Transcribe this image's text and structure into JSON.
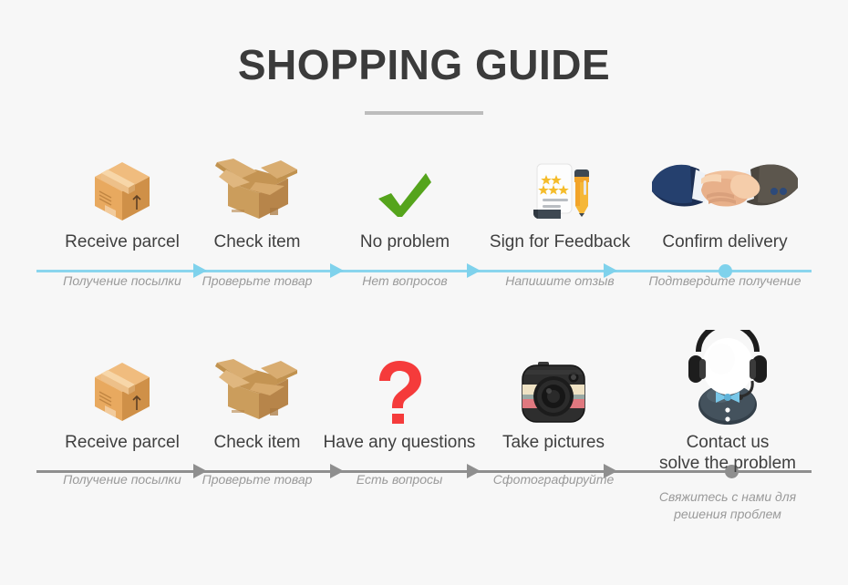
{
  "header": {
    "title": "SHOPPING GUIDE"
  },
  "colors": {
    "background": "#f7f7f7",
    "title": "#3b3b3b",
    "rule": "#bdbdbd",
    "label": "#3f3f3f",
    "sublabel": "#9a9a9a",
    "timeline_row1": "#7fd2ec",
    "timeline_row2": "#8f8f8f",
    "check_green": "#55a41c",
    "question_red": "#f53b3b",
    "star_yellow": "#f5bc2a",
    "box_tan": "#e8a95f",
    "bowtie_blue": "#79c7e8"
  },
  "rows": [
    {
      "name": "delivery-flow",
      "line_color": "#7fd2ec",
      "steps": [
        {
          "icon": "closed-box-icon",
          "label": "Receive parcel",
          "sub": "Получение посылки",
          "connector": "arrow"
        },
        {
          "icon": "open-box-icon",
          "label": "Check item",
          "sub": "Проверьте товар",
          "connector": "arrow"
        },
        {
          "icon": "green-check-icon",
          "label": "No problem",
          "sub": "Нет вопросов",
          "connector": "arrow"
        },
        {
          "icon": "feedback-form-icon",
          "label": "Sign for Feedback",
          "sub": "Напишите отзыв",
          "connector": "arrow"
        },
        {
          "icon": "handshake-icon",
          "label": "Confirm delivery",
          "sub": "Подтвердите получение",
          "connector": "dot"
        }
      ]
    },
    {
      "name": "problem-flow",
      "line_color": "#8f8f8f",
      "steps": [
        {
          "icon": "closed-box-icon",
          "label": "Receive parcel",
          "sub": "Получение посылки",
          "connector": "arrow"
        },
        {
          "icon": "open-box-icon",
          "label": "Check item",
          "sub": "Проверьте товар",
          "connector": "arrow"
        },
        {
          "icon": "question-mark-icon",
          "label": "Have any questions",
          "sub": "Есть вопросы",
          "connector": "arrow"
        },
        {
          "icon": "camera-icon",
          "label": "Take pictures",
          "sub": "Сфотографируйте",
          "connector": "arrow"
        },
        {
          "icon": "support-agent-icon",
          "label": "Contact us\nsolve the problem",
          "sub": "Свяжитесь с нами для решения проблем",
          "connector": "dot"
        }
      ]
    }
  ]
}
